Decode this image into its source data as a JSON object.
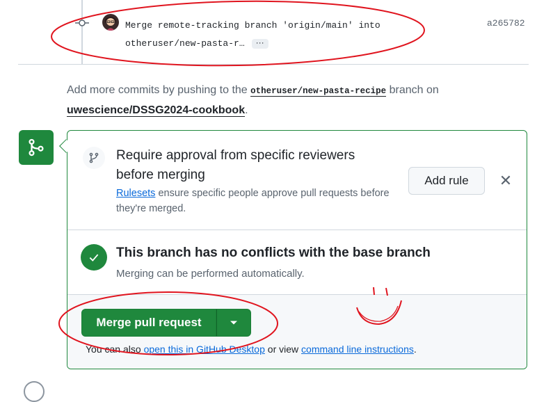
{
  "commit": {
    "message_line1": "Merge remote-tracking branch 'origin/main' into",
    "message_line2": "otheruser/new-pasta-r…",
    "ellipsis": "···",
    "sha": "a265782"
  },
  "push_hint": {
    "prefix": "Add more commits by pushing to the",
    "branch": "otheruser/new-pasta-recipe",
    "middle": "branch on",
    "repo": "uwescience/DSSG2024-cookbook",
    "suffix": "."
  },
  "ruleset": {
    "title": "Require approval from specific reviewers before merging",
    "link": "Rulesets",
    "desc": "ensure specific people approve pull requests before they're merged.",
    "add_rule_label": "Add rule",
    "close_label": "✕"
  },
  "conflicts": {
    "title": "This branch has no conflicts with the base branch",
    "desc": "Merging can be performed automatically."
  },
  "merge": {
    "button_label": "Merge pull request",
    "alt_prefix": "You can also",
    "desktop_link": "open this in GitHub Desktop",
    "alt_middle": "or view",
    "cli_link": "command line instructions",
    "alt_suffix": "."
  },
  "colors": {
    "success": "#1f883d",
    "link": "#0969da",
    "annotation": "#e0141e"
  },
  "icons": [
    "git-commit-icon",
    "avatar",
    "git-merge-icon",
    "git-branch-icon",
    "check-icon",
    "triangle-down-icon",
    "close-icon"
  ]
}
